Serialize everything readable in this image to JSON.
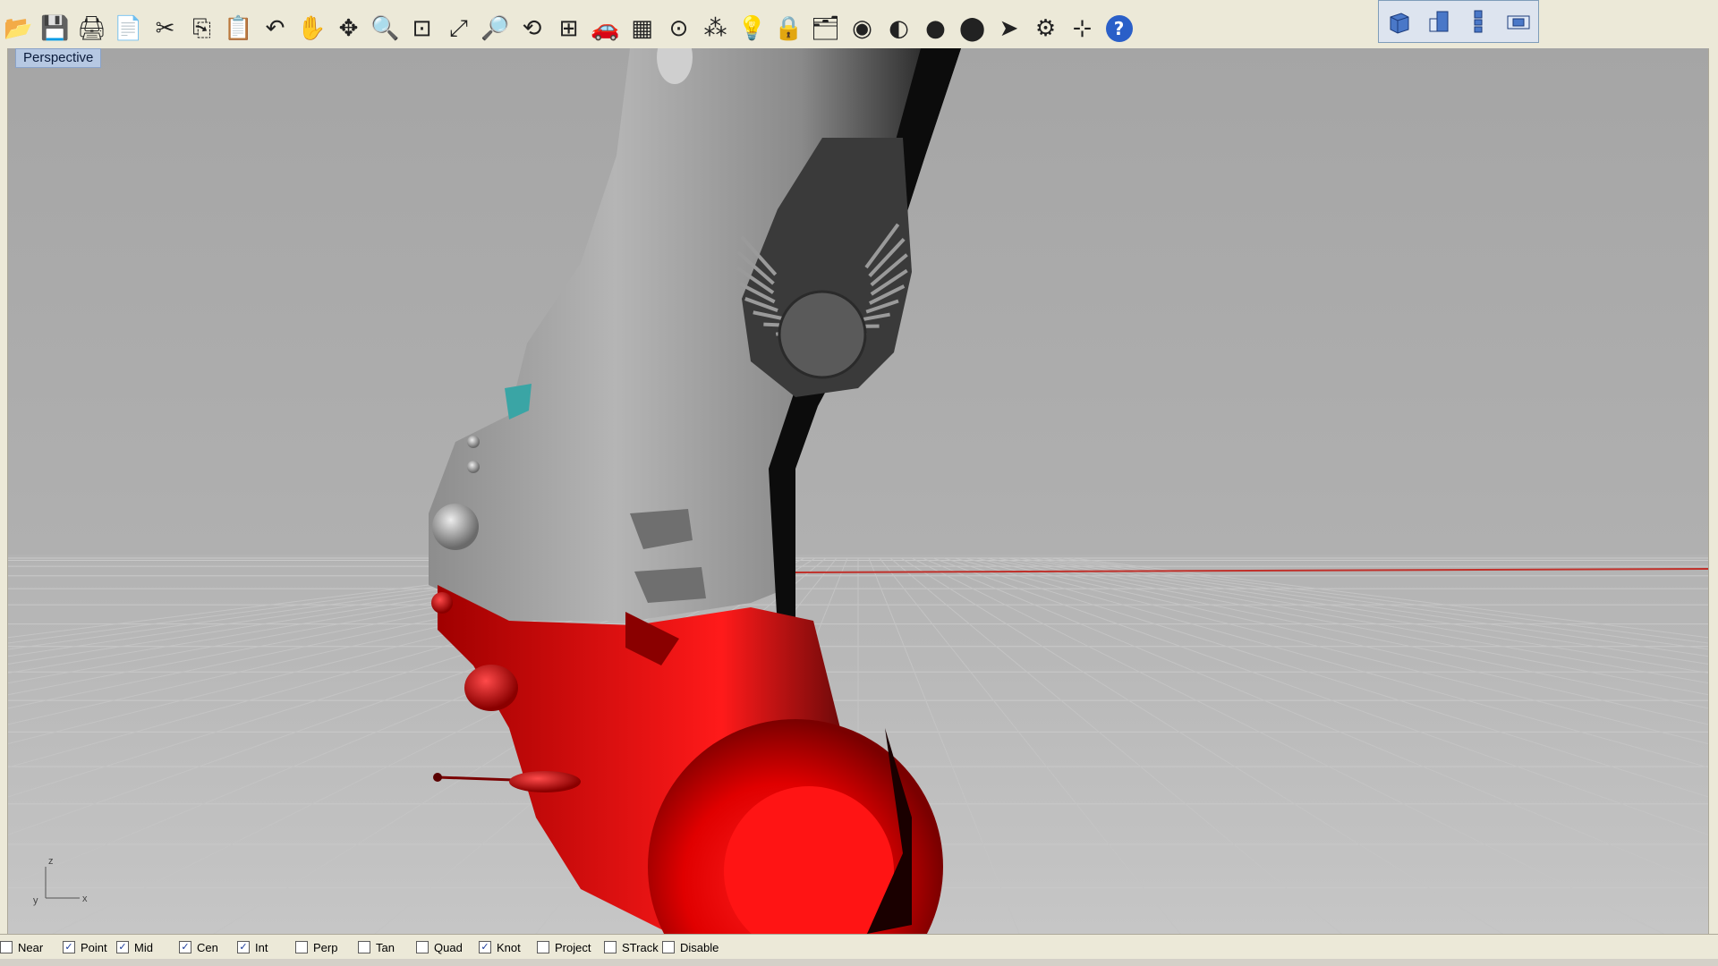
{
  "toolbar": {
    "buttons": [
      {
        "name": "open-icon",
        "glyph": "📂"
      },
      {
        "name": "save-icon",
        "glyph": "💾"
      },
      {
        "name": "print-icon",
        "glyph": "🖨"
      },
      {
        "name": "export-icon",
        "glyph": "📄"
      },
      {
        "name": "cut-icon",
        "glyph": "✂"
      },
      {
        "name": "copy-icon",
        "glyph": "⎘"
      },
      {
        "name": "paste-icon",
        "glyph": "📋"
      },
      {
        "name": "undo-icon",
        "glyph": "↶"
      },
      {
        "name": "pan-icon",
        "glyph": "✋"
      },
      {
        "name": "rotate-view-icon",
        "glyph": "✥"
      },
      {
        "name": "zoom-icon",
        "glyph": "🔍"
      },
      {
        "name": "zoom-window-icon",
        "glyph": "⊡"
      },
      {
        "name": "zoom-extents-icon",
        "glyph": "⤢"
      },
      {
        "name": "zoom-selected-icon",
        "glyph": "🔎"
      },
      {
        "name": "undo-view-icon",
        "glyph": "⟲"
      },
      {
        "name": "four-viewports-icon",
        "glyph": "⊞"
      },
      {
        "name": "car-icon",
        "glyph": "🚗"
      },
      {
        "name": "grid-icon",
        "glyph": "▦"
      },
      {
        "name": "circle-point-icon",
        "glyph": "⊙"
      },
      {
        "name": "points-icon",
        "glyph": "⁂"
      },
      {
        "name": "light-icon",
        "glyph": "💡"
      },
      {
        "name": "lock-icon",
        "glyph": "🔒"
      },
      {
        "name": "properties-icon",
        "glyph": "🗂"
      },
      {
        "name": "color-wheel-icon",
        "glyph": "◉"
      },
      {
        "name": "shaded-sphere-icon",
        "glyph": "◐"
      },
      {
        "name": "rendered-sphere-icon",
        "glyph": "●"
      },
      {
        "name": "blue-sphere-icon",
        "glyph": "⬤"
      },
      {
        "name": "pointer-icon",
        "glyph": "➤"
      },
      {
        "name": "options-gear-icon",
        "glyph": "⚙"
      },
      {
        "name": "dimension-icon",
        "glyph": "⊹"
      },
      {
        "name": "help-icon",
        "glyph": "?"
      }
    ],
    "view_buttons": [
      {
        "name": "perspective-view-icon"
      },
      {
        "name": "top-view-icon"
      },
      {
        "name": "front-view-icon"
      },
      {
        "name": "right-view-icon"
      }
    ]
  },
  "viewport": {
    "label": "Perspective",
    "axis_z": "z",
    "axis_x": "x",
    "axis_y": "y",
    "colors": {
      "background_top": "#a8a8a8",
      "ground": "#bcbcbc",
      "grid_line": "#c9c9c9",
      "x_axis": "#c0302a",
      "model_gray": "#a9a9a9",
      "model_red": "#e00000",
      "accent_teal": "#3aa5a5"
    }
  },
  "osnap": [
    {
      "label": "Near",
      "checked": false
    },
    {
      "label": "Point",
      "checked": true
    },
    {
      "label": "Mid",
      "checked": true
    },
    {
      "label": "Cen",
      "checked": true
    },
    {
      "label": "Int",
      "checked": true
    },
    {
      "label": "Perp",
      "checked": false
    },
    {
      "label": "Tan",
      "checked": false
    },
    {
      "label": "Quad",
      "checked": false
    },
    {
      "label": "Knot",
      "checked": true
    },
    {
      "label": "Project",
      "checked": false
    },
    {
      "label": "STrack",
      "checked": false
    },
    {
      "label": "Disable",
      "checked": false
    }
  ]
}
